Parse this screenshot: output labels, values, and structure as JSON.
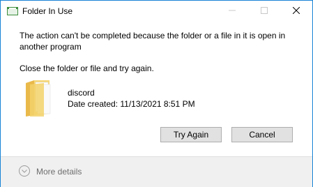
{
  "window": {
    "title": "Folder In Use",
    "controls": {
      "minimize": "–",
      "maximize": "☐",
      "close": "✕"
    }
  },
  "message": {
    "line1": "The action can't be completed because the folder or a file in it is open in another program",
    "line2": "Close the folder or file and try again."
  },
  "item": {
    "icon": "folder-icon",
    "name": "discord",
    "date_created": "Date created: 11/13/2021 8:51 PM"
  },
  "buttons": {
    "try_again": "Try Again",
    "cancel": "Cancel"
  },
  "footer": {
    "more_details": "More details",
    "icon": "chevron-down-circle-icon"
  },
  "colors": {
    "accent_border": "#1883d7",
    "folder_yellow": "#f3d26b",
    "footer_bg": "#f0f0f0"
  }
}
